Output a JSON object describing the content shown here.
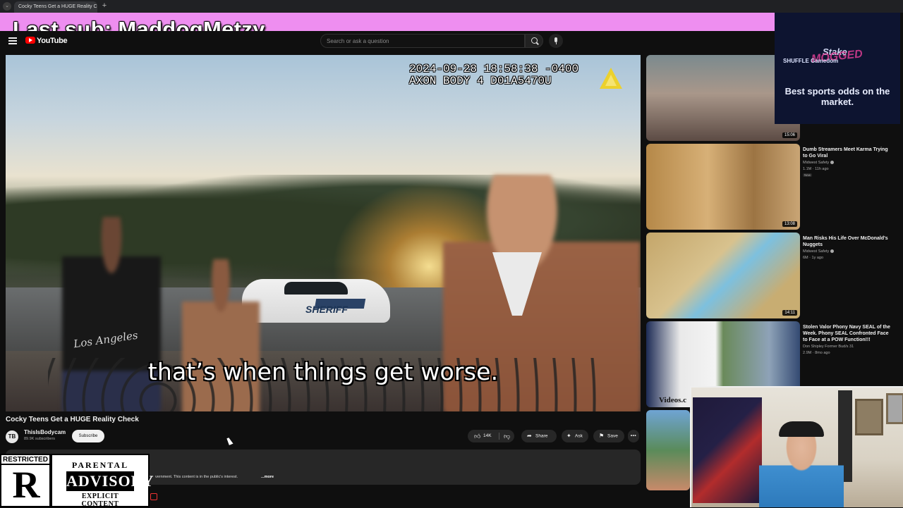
{
  "browser": {
    "tab_title": "Cocky Teens Get a HUGE Reality Check",
    "new_tab": "+"
  },
  "overlay": {
    "last_sub": "Last sub: MaddogMetzy"
  },
  "header": {
    "logo_text": "YouTube",
    "search_placeholder": "Search or ask a question"
  },
  "player": {
    "timestamp_line1": "2024-09-28 18:58:38 -0400",
    "timestamp_line2": "AXON BODY 4 D01A5470U",
    "caption": "that’s when things get worse.",
    "shirt_text": "Los Angeles",
    "car_label": "SHERIFF"
  },
  "video": {
    "title": "Cocky Teens Get a HUGE Reality Check",
    "channel_avatar": "TB",
    "channel_name": "ThisIsBodycam",
    "channel_subs": "89.9K subscribers",
    "subscribe_label": "Subscribe",
    "like_count": "14K",
    "share_label": "Share",
    "ask_label": "Ask",
    "save_label": "Save",
    "more_label": "•••",
    "description_snippet": "vernment. This content is in the public's interest.",
    "description_more": "...more"
  },
  "stickers": {
    "restricted_label": "RESTRICTED",
    "restricted_letter": "R",
    "advisory_top": "PARENTAL",
    "advisory_mid": "ADVISORY",
    "advisory_bottom": "EXPLICIT CONTENT"
  },
  "recommendations": [
    {
      "title": "",
      "channel": "",
      "meta": "",
      "duration": "15:06"
    },
    {
      "title": "Dumb Streamers Meet Karma Trying to Go Viral",
      "channel": "Midwest Safety",
      "meta": "1.1M · 11h ago",
      "badge": "New",
      "duration": "13:08"
    },
    {
      "title": "Man Risks His Life Over McDonald's Nuggets",
      "channel": "Midwest Safety",
      "meta": "6M · 1y ago",
      "duration": "14:11"
    },
    {
      "title": "Stolen Valor Phony Navy SEAL of the Week. Phony SEAL Confronted Face to Face at a POW Function!!!",
      "channel": "Don Shipley Former Bud/s 31",
      "meta": "2.9M · 8mo ago",
      "thumb_text": "Videos.c"
    }
  ],
  "ad": {
    "brand": "Stake",
    "overlay_text": "MOGGED",
    "partners": "SHUFFLE  Gamedom",
    "tagline": "Best sports odds on the market."
  }
}
